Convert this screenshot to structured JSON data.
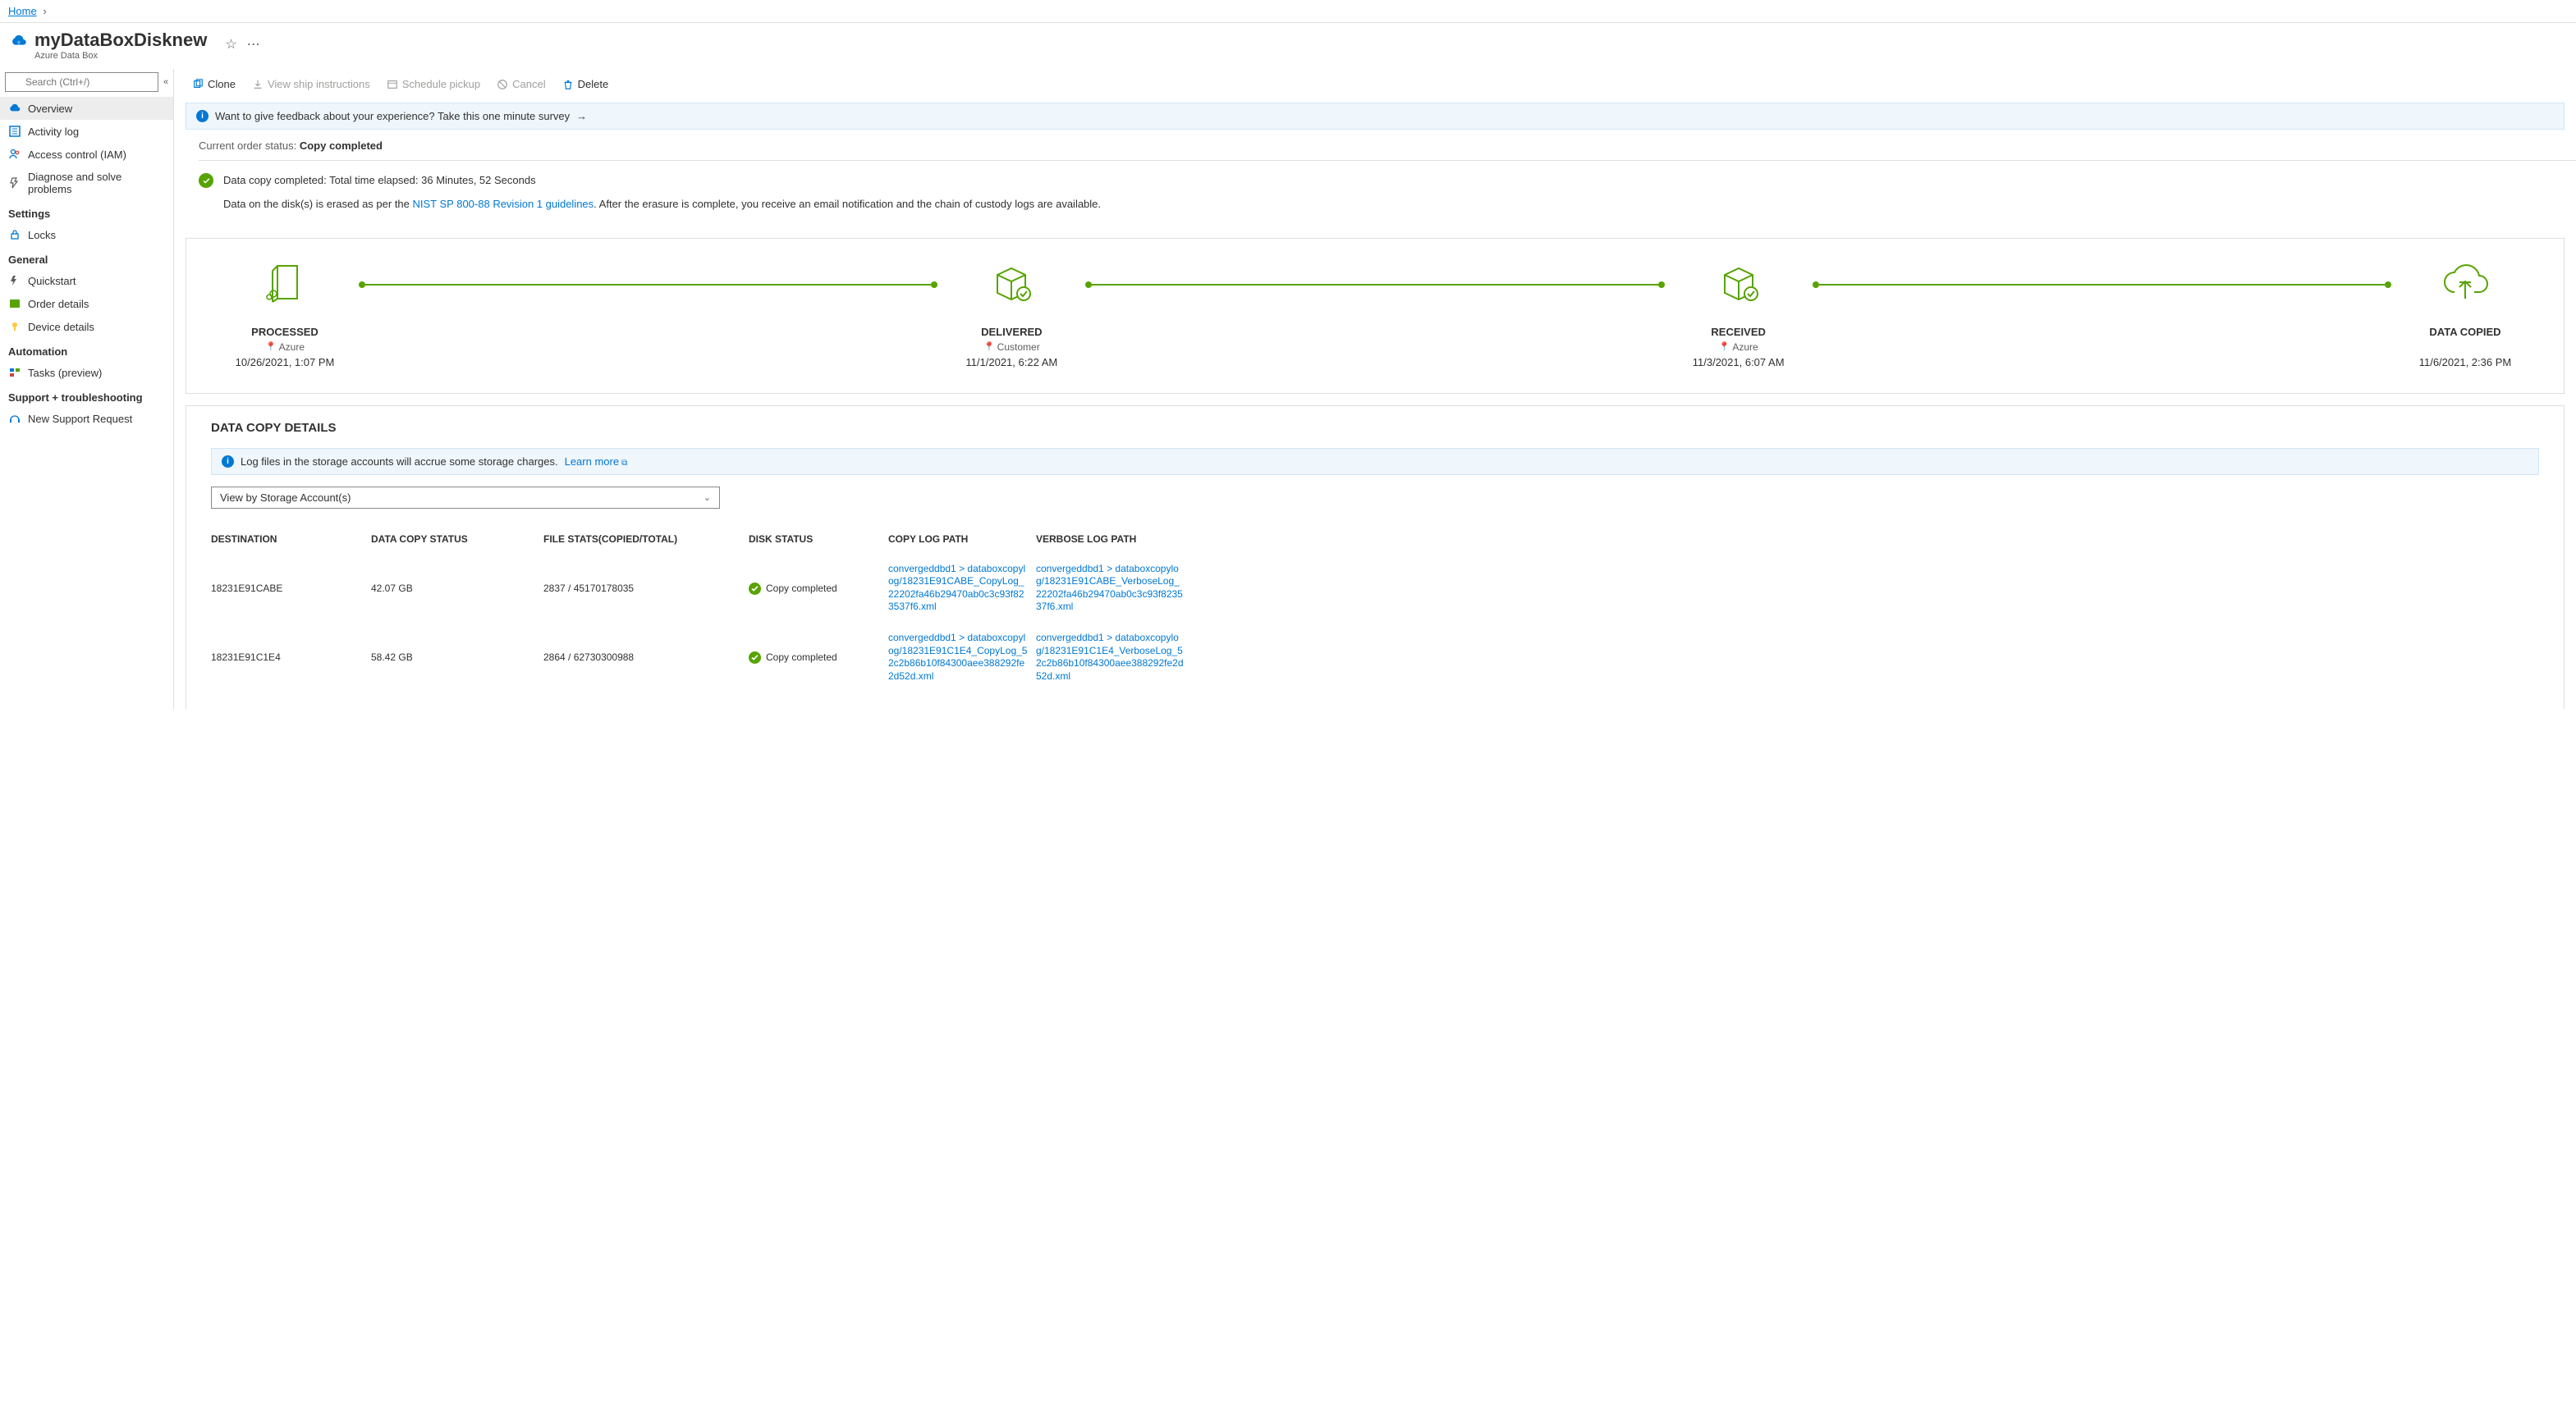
{
  "breadcrumb": {
    "home": "Home"
  },
  "header": {
    "title": "myDataBoxDisknew",
    "subtitle": "Azure Data Box"
  },
  "search": {
    "placeholder": "Search (Ctrl+/)"
  },
  "nav": {
    "overview": "Overview",
    "activity": "Activity log",
    "iam": "Access control (IAM)",
    "diagnose": "Diagnose and solve problems",
    "headings": {
      "settings": "Settings",
      "general": "General",
      "automation": "Automation",
      "support": "Support + troubleshooting"
    },
    "locks": "Locks",
    "quickstart": "Quickstart",
    "orderdetails": "Order details",
    "devicedetails": "Device details",
    "tasks": "Tasks (preview)",
    "newsupport": "New Support Request"
  },
  "toolbar": {
    "clone": "Clone",
    "viewship": "View ship instructions",
    "schedule": "Schedule pickup",
    "cancel": "Cancel",
    "delete": "Delete"
  },
  "banner": {
    "feedback": "Want to give feedback about your experience? Take this one minute survey"
  },
  "status": {
    "label": "Current order status: ",
    "value": "Copy completed"
  },
  "copymsg": {
    "line1": "Data copy completed: Total time elapsed: 36 Minutes, 52 Seconds",
    "line2a": "Data on the disk(s) is erased as per the ",
    "line2link": "NIST SP 800-88 Revision 1 guidelines",
    "line2b": ". After the erasure is complete, you receive an email notification and the chain of custody logs are available."
  },
  "timeline": {
    "steps": [
      {
        "title": "PROCESSED",
        "loc": "Azure",
        "date": "10/26/2021, 1:07 PM"
      },
      {
        "title": "DELIVERED",
        "loc": "Customer",
        "date": "11/1/2021, 6:22 AM"
      },
      {
        "title": "RECEIVED",
        "loc": "Azure",
        "date": "11/3/2021, 6:07 AM"
      },
      {
        "title": "DATA COPIED",
        "loc": "",
        "date": "11/6/2021, 2:36 PM"
      }
    ]
  },
  "details": {
    "title": "DATA COPY DETAILS",
    "banner": "Log files in the storage accounts will accrue some storage charges.",
    "learnmore": "Learn more",
    "select": "View by Storage Account(s)",
    "headers": {
      "dest": "DESTINATION",
      "status": "DATA COPY STATUS",
      "file": "FILE STATS(COPIED/TOTAL)",
      "disk": "DISK STATUS",
      "log": "COPY LOG PATH",
      "vlog": "VERBOSE LOG PATH"
    },
    "rows": [
      {
        "dest": "18231E91CABE",
        "status": "42.07 GB",
        "file": "2837 / 45170178035",
        "disk": "Copy completed",
        "log": "convergeddbd1 > databoxcopylog/18231E91CABE_CopyLog_22202fa46b29470ab0c3c93f823537f6.xml",
        "vlog": "convergeddbd1 > databoxcopylog/18231E91CABE_VerboseLog_22202fa46b29470ab0c3c93f823537f6.xml"
      },
      {
        "dest": "18231E91C1E4",
        "status": "58.42 GB",
        "file": "2864 / 62730300988",
        "disk": "Copy completed",
        "log": "convergeddbd1 > databoxcopylog/18231E91C1E4_CopyLog_52c2b86b10f84300aee388292fe2d52d.xml",
        "vlog": "convergeddbd1 > databoxcopylog/18231E91C1E4_VerboseLog_52c2b86b10f84300aee388292fe2d52d.xml"
      }
    ]
  }
}
